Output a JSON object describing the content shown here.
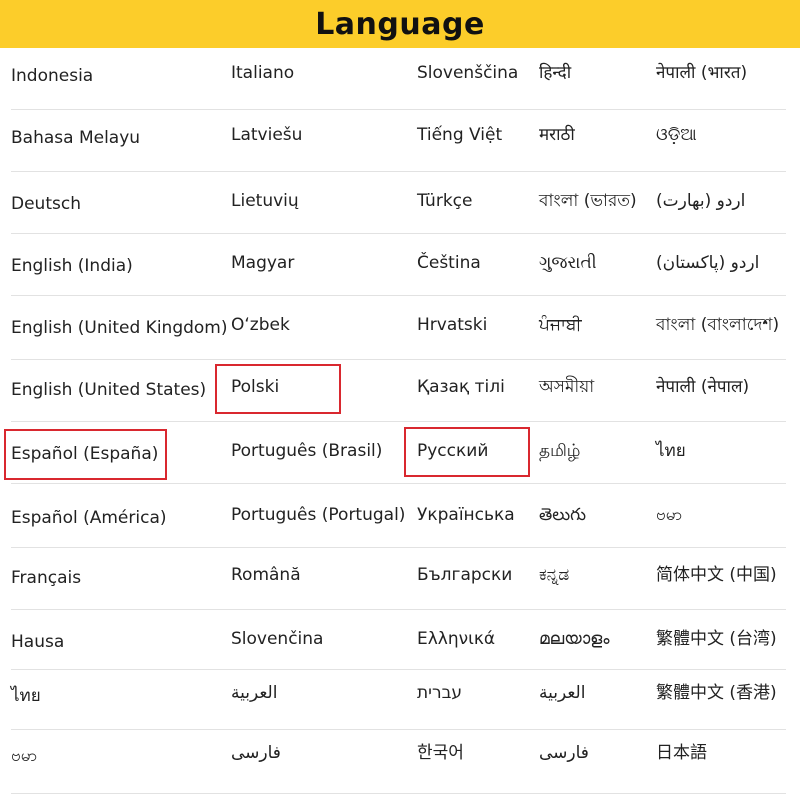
{
  "header": {
    "title": "Language"
  },
  "rows": [
    [
      "Indonesia",
      "Italiano",
      "Slovenščina",
      "हिन्दी",
      "नेपाली (भारत)"
    ],
    [
      "Bahasa Melayu",
      "Latviešu",
      "Tiếng Việt",
      "मराठी",
      "ଓଡ଼ିଆ"
    ],
    [
      "Deutsch",
      "Lietuvių",
      "Türkçe",
      "বাংলা (ভারত)",
      "اردو (بھارت)"
    ],
    [
      "English (India)",
      "Magyar",
      "Čeština",
      "ગુજરાતી",
      "اردو (پاکستان)"
    ],
    [
      "English (United Kingdom)",
      "Oʻzbek",
      "Hrvatski",
      "ਪੰਜਾਬੀ",
      "বাংলা (বাংলাদেশ)"
    ],
    [
      "English (United States)",
      "Polski",
      "Қазақ тілі",
      "অসমীয়া",
      "नेपाली (नेपाल)"
    ],
    [
      "Español (España)",
      "Português (Brasil)",
      "Русский",
      "தமிழ்",
      "ไทย"
    ],
    [
      "Español (América)",
      "Português (Portugal)",
      "Українська",
      "తెలుగు",
      "ဗမာ"
    ],
    [
      "Français",
      "Română",
      "Български",
      "ಕನ್ನಡ",
      "简体中文 (中国)"
    ],
    [
      "Hausa",
      "Slovenčina",
      "Ελληνικά",
      "മലയാളം",
      "繁體中文 (台湾)"
    ],
    [
      "ไทย",
      "العربية",
      "עברית",
      "العربية",
      "繁體中文 (香港)"
    ],
    [
      "ဗမာ",
      "فارسی",
      "한국어",
      "فارسی",
      "日本語"
    ]
  ],
  "highlighted": [
    "Polski",
    "Español (España)",
    "Русский"
  ],
  "colors": {
    "header_bg": "#fccd2a",
    "highlight": "#d9282f",
    "divider": "#e2e2e2"
  }
}
